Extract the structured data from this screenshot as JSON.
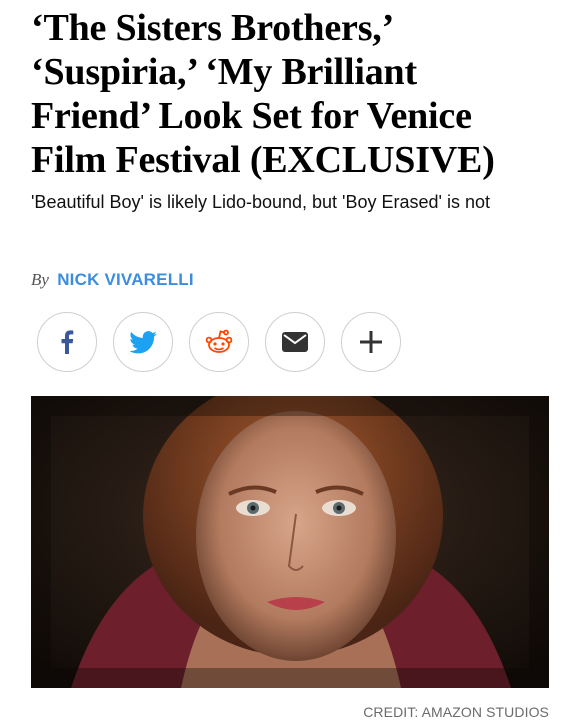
{
  "article": {
    "headline_lines": [
      "‘The Sisters Brothers,’",
      "‘Suspiria,’ ‘My Brilliant",
      "Friend’ Look Set for Venice",
      "Film Festival (EXCLUSIVE)"
    ],
    "dek": "'Beautiful Boy' is likely Lido-bound, but 'Boy Erased' is not",
    "byline_prefix": "By",
    "author": "NICK VIVARELLI"
  },
  "share": {
    "buttons": [
      {
        "icon": "facebook-icon",
        "color": "#3b5998"
      },
      {
        "icon": "twitter-icon",
        "color": "#1da1f2"
      },
      {
        "icon": "reddit-icon",
        "color": "#ff4500"
      },
      {
        "icon": "email-icon",
        "color": "#333333"
      },
      {
        "icon": "plus-icon",
        "color": "#333333"
      }
    ]
  },
  "image": {
    "credit": "CREDIT: AMAZON STUDIOS"
  }
}
